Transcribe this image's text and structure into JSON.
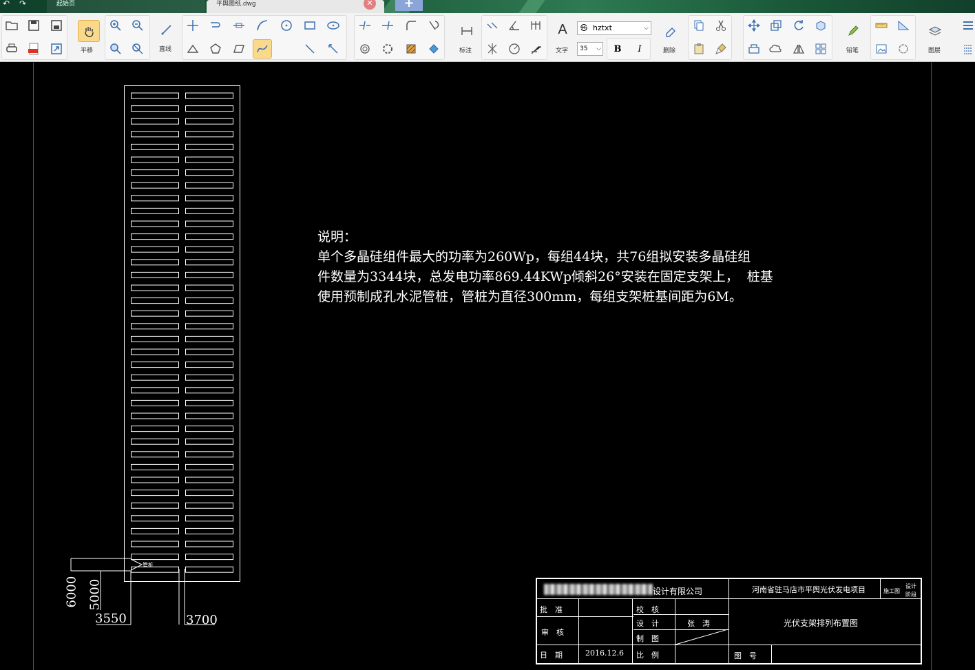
{
  "tabs": {
    "home": "起始页",
    "file": "平舆图纸.dwg",
    "close": "✕",
    "add": "+"
  },
  "toolbar": {
    "pan_label": "平移",
    "line_label": "直线",
    "dim_label": "标注",
    "text_label": "文字",
    "font_name": "hztxt",
    "font_size": "35",
    "bold": "B",
    "italic": "I",
    "delete_label": "删除",
    "pencil_label": "铅笔",
    "layer_label": "图层",
    "text_icon": "A",
    "font_icon": "㉿"
  },
  "drawing": {
    "note_lines": [
      "说明：",
      "单个多晶硅组件最大的功率为260Wp，每组44块，共76组拟安装多晶硅组",
      "件数量为3344块，总发电功率869.44KWp倾斜26°安装在固定支架上，  桩基",
      "使用预制成孔水泥管桩，管桩为直径300mm，每组支架桩基间距为6M。"
    ],
    "pile_tag": "管桩",
    "dims": {
      "d6000": "6000",
      "d5000": "5000",
      "d3550": "3550",
      "d3700": "3700"
    },
    "panel_rows": 38
  },
  "title_block": {
    "company": "设计有限公司",
    "project": "河南省驻马店市平舆光伏发电项目",
    "stage_a": "施工图",
    "stage_b1": "设计",
    "stage_b2": "阶段",
    "approve": "批　准",
    "check": "校　核",
    "review": "审　核",
    "design": "设　计",
    "designer": "张　涛",
    "draw": "制　图",
    "date_label": "日　期",
    "date": "2016.12.6",
    "scale": "比　例",
    "drawing_no": "图　号",
    "drawing_title": "光伏支架排列布置图"
  }
}
